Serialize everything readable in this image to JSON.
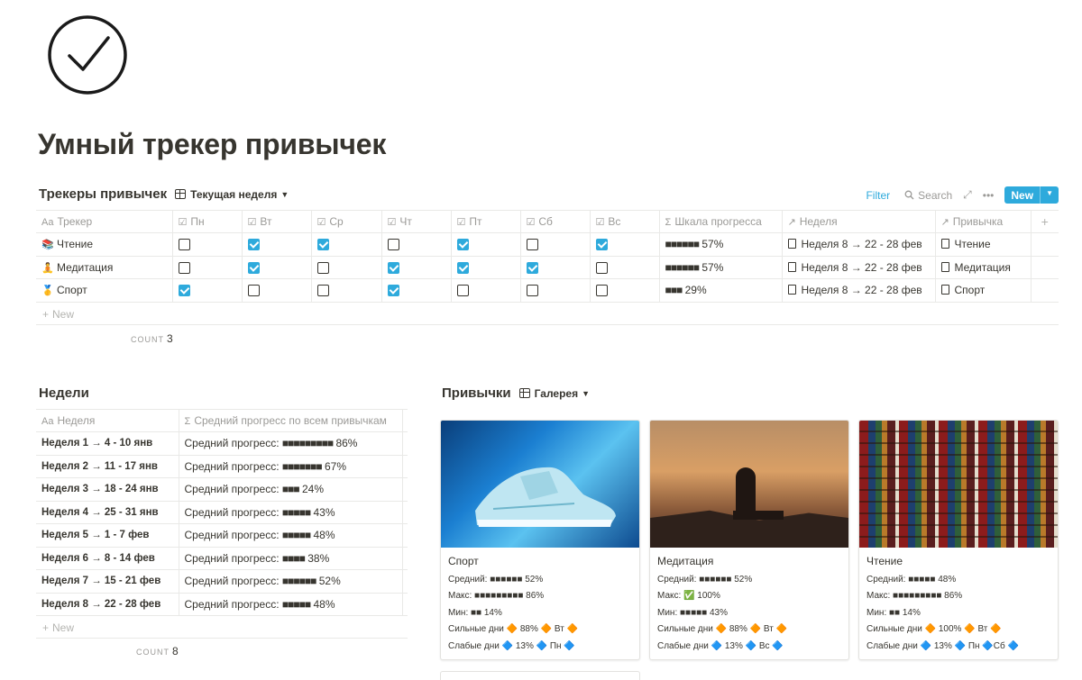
{
  "page": {
    "title": "Умный трекер привычек",
    "icon": "check-circle-icon"
  },
  "trackers": {
    "title": "Трекеры привычек",
    "view_label": "Текущая неделя",
    "toolbar": {
      "filter": "Filter",
      "search": "Search",
      "new": "New"
    },
    "columns": [
      "Трекер",
      "Пн",
      "Вт",
      "Ср",
      "Чт",
      "Пт",
      "Сб",
      "Вс",
      "Шкала прогресса",
      "Неделя",
      "Привычка"
    ],
    "rows": [
      {
        "emoji": "📚",
        "name": "Чтение",
        "days": [
          false,
          true,
          true,
          false,
          true,
          false,
          true
        ],
        "bar": "■■■■■■",
        "progress": "57%",
        "week": "Неделя 8 → 22 - 28 фев",
        "habit": "Чтение"
      },
      {
        "emoji": "🧘",
        "name": "Медитация",
        "days": [
          false,
          true,
          false,
          true,
          true,
          true,
          false
        ],
        "bar": "■■■■■■",
        "progress": "57%",
        "week": "Неделя 8 → 22 - 28 фев",
        "habit": "Медитация"
      },
      {
        "emoji": "🥇",
        "name": "Спорт",
        "days": [
          true,
          false,
          false,
          true,
          false,
          false,
          false
        ],
        "bar": "■■■",
        "progress": "29%",
        "week": "Неделя 8 → 22 - 28 фев",
        "habit": "Спорт"
      }
    ],
    "add_new": "New",
    "count_label": "COUNT",
    "count_value": "3"
  },
  "weeks": {
    "title": "Недели",
    "columns": [
      "Неделя",
      "Средний прогресс по всем привычкам"
    ],
    "rows": [
      {
        "name": "Неделя 1 → 4 - 10 янв",
        "label": "Средний прогресс:",
        "bar": "■■■■■■■■■",
        "value": "86%"
      },
      {
        "name": "Неделя 2 → 11 - 17 янв",
        "label": "Средний прогресс:",
        "bar": "■■■■■■■",
        "value": "67%"
      },
      {
        "name": "Неделя 3 → 18 - 24 янв",
        "label": "Средний прогресс:",
        "bar": "■■■",
        "value": "24%"
      },
      {
        "name": "Неделя 4 → 25 - 31 янв",
        "label": "Средний прогресс:",
        "bar": "■■■■■",
        "value": "43%"
      },
      {
        "name": "Неделя 5 → 1 - 7 фев",
        "label": "Средний прогресс:",
        "bar": "■■■■■",
        "value": "48%"
      },
      {
        "name": "Неделя 6 → 8 - 14 фев",
        "label": "Средний прогресс:",
        "bar": "■■■■",
        "value": "38%"
      },
      {
        "name": "Неделя 7 → 15 - 21 фев",
        "label": "Средний прогресс:",
        "bar": "■■■■■■",
        "value": "52%"
      },
      {
        "name": "Неделя 8 → 22 - 28 фев",
        "label": "Средний прогресс:",
        "bar": "■■■■■",
        "value": "48%"
      }
    ],
    "add_new": "New",
    "count_label": "COUNT",
    "count_value": "8"
  },
  "habits": {
    "title": "Привычки",
    "view_label": "Галерея",
    "cards": [
      {
        "title": "Спорт",
        "avg": "Средний: ■■■■■■ 52%",
        "max": "Макс: ■■■■■■■■■ 86%",
        "min": "Мин: ■■ 14%",
        "strong": "Сильные дни 🔶 88% 🔶 Вт 🔶",
        "weak": "Слабые дни 🔷 13% 🔷 Пн 🔷"
      },
      {
        "title": "Медитация",
        "avg": "Средний: ■■■■■■ 52%",
        "max": "Макс: ✅ 100%",
        "min": "Мин: ■■■■■ 43%",
        "strong": "Сильные дни 🔶 88% 🔶 Вт 🔶",
        "weak": "Слабые дни 🔷 13% 🔷 Вс 🔷"
      },
      {
        "title": "Чтение",
        "avg": "Средний: ■■■■■ 48%",
        "max": "Макс: ■■■■■■■■■ 86%",
        "min": "Мин: ■■ 14%",
        "strong": "Сильные дни 🔶 100% 🔶 Вт 🔶",
        "weak": "Слабые дни 🔷 13% 🔷 Пн 🔷Сб 🔷"
      }
    ]
  }
}
